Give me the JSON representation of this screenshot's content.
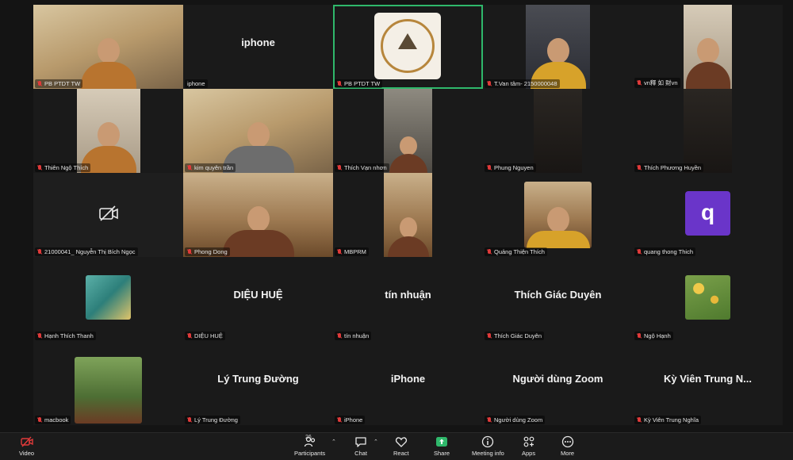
{
  "tiles": [
    {
      "name": "PB PTDT TW"
    },
    {
      "name": "iphone",
      "display": "iphone"
    },
    {
      "name": "PB PTDT TW"
    },
    {
      "name": "T.Van tâm- 2150000048"
    },
    {
      "name": "vn釋 如 財vn"
    },
    {
      "name": "Thiên Ngộ Thích"
    },
    {
      "name": "kim quyên trần"
    },
    {
      "name": "Thích Vạn nhơn"
    },
    {
      "name": "Phung Nguyen"
    },
    {
      "name": "Thích Phương Huyền"
    },
    {
      "name": "21000041_ Nguyễn Thị Bích Ngọc"
    },
    {
      "name": "Phong Dong"
    },
    {
      "name": "MBPRM"
    },
    {
      "name": "Quảng Thiện Thích"
    },
    {
      "name": "quang thong Thich",
      "avatar": "q"
    },
    {
      "name": "Hạnh Thích Thanh"
    },
    {
      "name": "DIỆU HUỆ",
      "display": "DIỆU HUỆ"
    },
    {
      "name": "tín nhuận",
      "display": "tín nhuận"
    },
    {
      "name": "Thích Giác Duyên",
      "display": "Thích Giác Duyên"
    },
    {
      "name": "Ngộ Hạnh"
    },
    {
      "name": "macbook"
    },
    {
      "name": "Lý Trung Đường",
      "display": "Lý Trung Đường"
    },
    {
      "name": "iPhone",
      "display": "iPhone"
    },
    {
      "name": "Người dùng Zoom",
      "display": "Người dùng Zoom"
    },
    {
      "name": "Kỳ Viên Trung Nghĩa",
      "display": "Kỳ Viên Trung N..."
    }
  ],
  "toolbar": {
    "video": "Video",
    "participants": "Participants",
    "participants_count": "26",
    "chat": "Chat",
    "react": "React",
    "share": "Share",
    "meeting_info": "Meeting info",
    "apps": "Apps",
    "more": "More"
  },
  "colors": {
    "active_border": "#2fb86b",
    "muted_mic": "#e03a3a",
    "share_green": "#2fb86b",
    "avatar_purple": "#6a35c9"
  }
}
